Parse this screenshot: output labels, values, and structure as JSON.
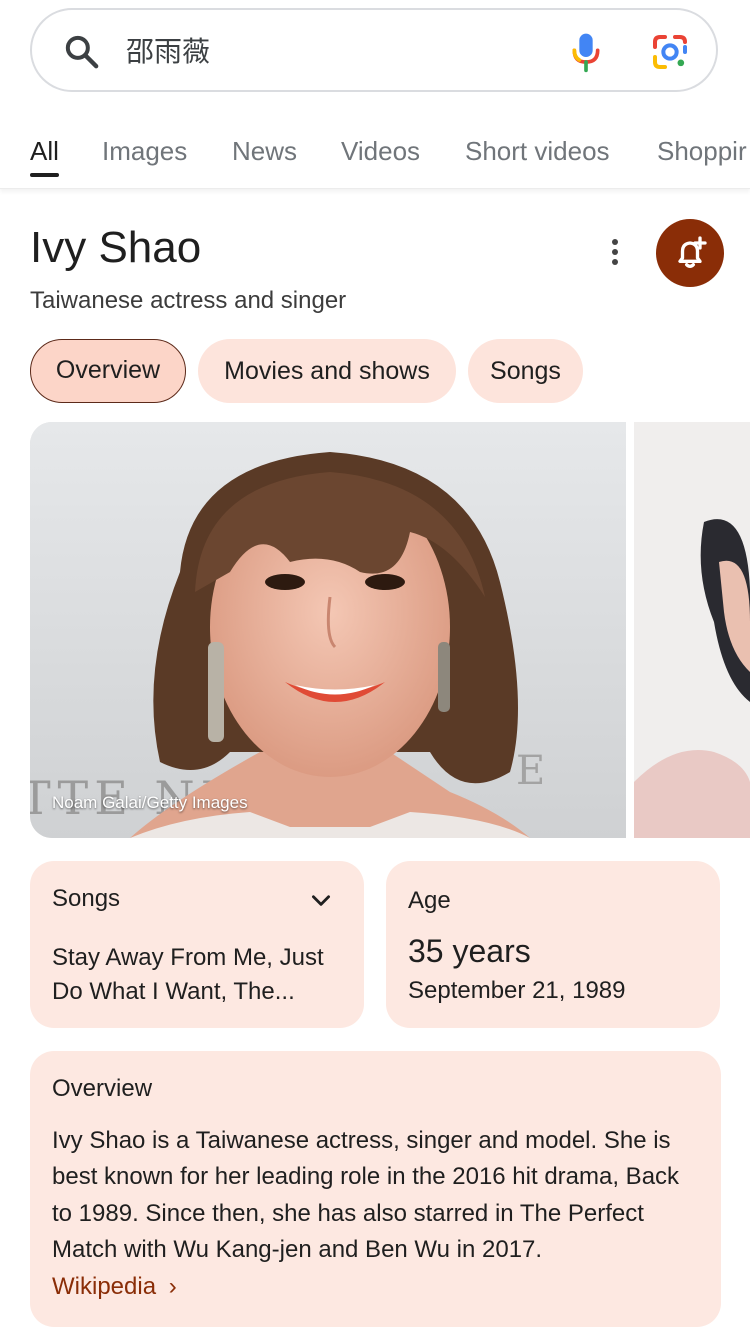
{
  "search": {
    "query": "邵雨薇",
    "icons": [
      "search-icon",
      "mic-icon",
      "google-lens-icon"
    ]
  },
  "tabs": [
    {
      "label": "All",
      "active": true
    },
    {
      "label": "Images",
      "active": false
    },
    {
      "label": "News",
      "active": false
    },
    {
      "label": "Videos",
      "active": false
    },
    {
      "label": "Short videos",
      "active": false
    },
    {
      "label": "Shoppir",
      "active": false
    }
  ],
  "entity": {
    "title": "Ivy Shao",
    "subtitle": "Taiwanese actress and singer",
    "icons": [
      "more-vert-icon",
      "add-notification-bell-icon"
    ]
  },
  "chips": [
    {
      "label": "Overview",
      "selected": true
    },
    {
      "label": "Movies and shows",
      "selected": false
    },
    {
      "label": "Songs",
      "selected": false
    }
  ],
  "images": {
    "credit": "Noam Galai/Getty Images",
    "backdrop_fragment": "TTE NEW"
  },
  "songs_card": {
    "label": "Songs",
    "value_line1": "Stay Away From Me, Just",
    "value_line2": "Do What I Want, The..."
  },
  "age_card": {
    "label": "Age",
    "value": "35 years",
    "birthdate": "September 21, 1989"
  },
  "overview_card": {
    "label": "Overview",
    "text": "Ivy Shao is a Taiwanese actress, singer and model. She is best known for her leading role in the 2016 hit drama, Back to 1989. Since then, she has also starred in The Perfect Match with Wu Kang-jen and Ben Wu in 2017.",
    "link_label": "Wikipedia",
    "link_chevron": "›"
  },
  "colors": {
    "accent": "#8a2d07",
    "chip_bg": "#fde4dc",
    "chip_selected_bg": "#fcd5c8",
    "card_bg": "#fde8e1"
  }
}
